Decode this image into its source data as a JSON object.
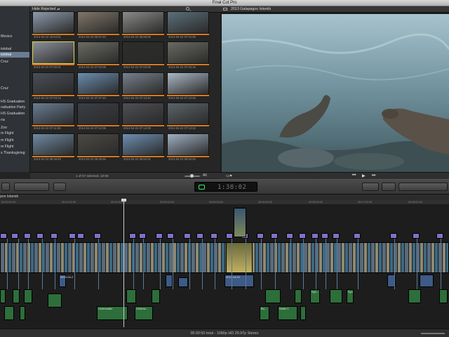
{
  "window": {
    "title": "Final Cut Pro"
  },
  "library": {
    "items": [
      {
        "label": "Mexico"
      },
      {
        "label": "istobal"
      },
      {
        "label": "istobal",
        "selected": true
      },
      {
        "label": "Cruz"
      },
      {
        "label": "Cruz"
      },
      {
        "label": "HS Graduation"
      },
      {
        "label": "raduation Party"
      },
      {
        "label": "HS Graduation"
      },
      {
        "label": "na"
      },
      {
        "label": "Zoo"
      },
      {
        "label": "m Flight"
      },
      {
        "label": "m Flight"
      },
      {
        "label": "m Flight"
      },
      {
        "label": "s Thanksgiving"
      }
    ]
  },
  "browser": {
    "filter_label": "Hide Rejected",
    "selection_info": "1 of 67 selected, 10:06",
    "zoom_label": "All",
    "thumbnails": [
      {
        "label": "2013-04-22 16:54:51",
        "color": "#8c9bab"
      },
      {
        "label": "2013-04-22 06:57:40",
        "color": "#7f7668"
      },
      {
        "label": "2013-04-22 06:56:06",
        "color": "#8a8a88"
      },
      {
        "label": "2013-04-22 07:01:05",
        "color": "#5b6f7a"
      },
      {
        "label": "2013-04-22 07:02:01",
        "color": "#8a8f99",
        "selected": true
      },
      {
        "label": "2013-04-22 07:02:06",
        "color": "#6b6c64"
      },
      {
        "label": "2013-04-22 07:03:06",
        "color": "#2c2c2a"
      },
      {
        "label": "2013-04-22 07:03:16",
        "color": "#6a6a63"
      },
      {
        "label": "2013-04-22 07:03:22",
        "color": "#4a4f58"
      },
      {
        "label": "2013-04-22 07:07:40",
        "color": "#6b8caf"
      },
      {
        "label": "2013-04-22 07:10:42",
        "color": "#77808a"
      },
      {
        "label": "2013-04-22 07:10:46",
        "color": "#aab7c4"
      },
      {
        "label": "2013-04-22 07:11:08",
        "color": "#6a7d92"
      },
      {
        "label": "2013-04-22 07:12:05",
        "color": "#3b3f46"
      },
      {
        "label": "2013-04-22 07:12:09",
        "color": "#4f4f55"
      },
      {
        "label": "2013-04-22 07:13:22",
        "color": "#5c6469"
      },
      {
        "label": "2013-04-22 06:46:40",
        "color": "#6f8aa3"
      },
      {
        "label": "2013-04-22 06:49:45",
        "color": "#4d4a44"
      },
      {
        "label": "2013-04-22 06:52:01",
        "color": "#6f8fb2"
      },
      {
        "label": "2013-04-22 06:52:02",
        "color": "#9fb0c2"
      }
    ]
  },
  "viewer": {
    "title": "2013 Galapagos Islands"
  },
  "toolbar": {
    "timecode": "1:38:02"
  },
  "timeline": {
    "project_name": "pos Islands",
    "ruler_ticks": [
      "00:00:00:00",
      "00:01:00:00",
      "00:02:00:00",
      "00:03:00:00",
      "00:04:00:00",
      "00:05:00:00",
      "00:06:00:00",
      "00:07:00:00",
      "00:08:00:00"
    ],
    "clip_labels": {
      "storyline_a": "2013-04-22",
      "storyline_b": "2013-04-2",
      "water_1": "Water...",
      "water_2": "Water ll",
      "underwater_1": "Underwater",
      "underwater_2": "Underw...",
      "sync_1": "Syn...",
      "sync_2": "Syn",
      "bu": "Bu..."
    }
  },
  "status": {
    "duration_info": "05:00:50 total - 1080p HD 29.97p Stereo"
  }
}
